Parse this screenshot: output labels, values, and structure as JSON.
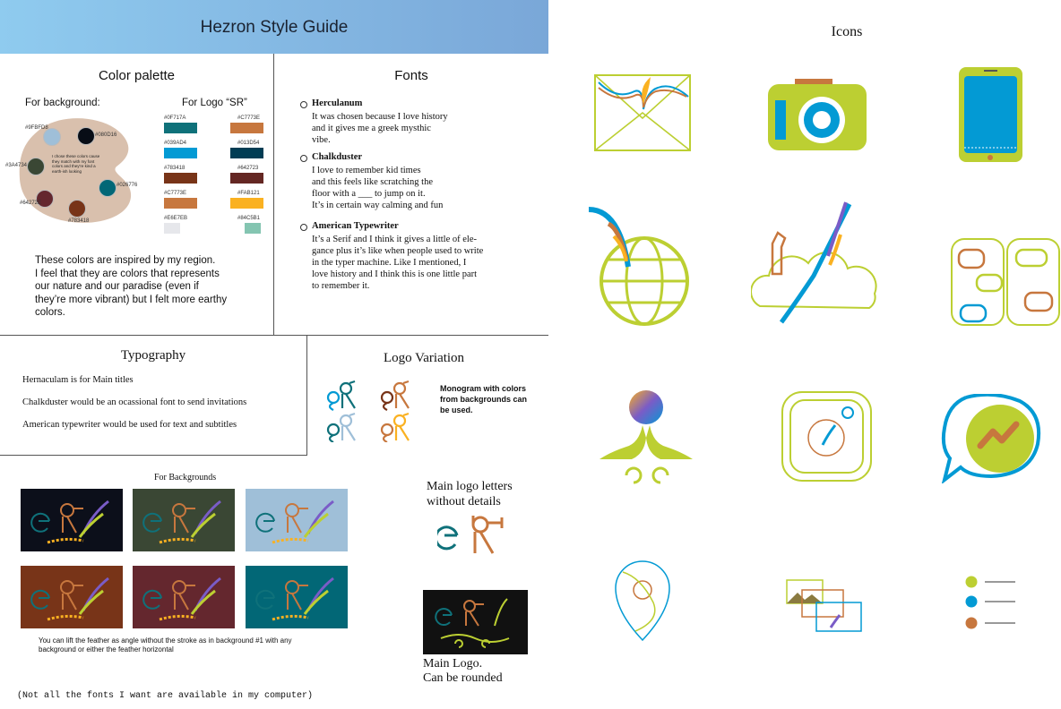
{
  "header": {
    "title": "Hezron Style Guide"
  },
  "color_palette": {
    "title": "Color palette",
    "background_label": "For background:",
    "logo_label": "For Logo “SR”",
    "palette_dots": [
      {
        "hex": "#9FBFD8",
        "label": "#9FBFD8"
      },
      {
        "hex": "#080D16",
        "label": "#080D16"
      },
      {
        "hex": "#3A4734",
        "label": "#3A4734"
      },
      {
        "hex": "#026776",
        "label": "#026776"
      },
      {
        "hex": "#64272E",
        "label": "#64272E"
      },
      {
        "hex": "#783418",
        "label": "#783418"
      }
    ],
    "palette_note": "I chose these colors cause they match with my font colors and they're kind a earth-ish looking",
    "logo_swatches": [
      {
        "hex": "#0F717A",
        "label": "#0F717A"
      },
      {
        "hex": "#C7773E",
        "label": "#C7773E"
      },
      {
        "hex": "#039AD4",
        "label": "#039AD4"
      },
      {
        "hex": "#013D54",
        "label": "#013D54"
      },
      {
        "hex": "#783418",
        "label": "#783418"
      },
      {
        "hex": "#642723",
        "label": "#642723"
      },
      {
        "hex": "#C7773E",
        "label": "#C7773E"
      },
      {
        "hex": "#FAB121",
        "label": "#FAB121"
      },
      {
        "hex": "#E6E7EB",
        "label": "#E6E7EB"
      },
      {
        "hex": "#84C5B1",
        "label": "#84C5B1"
      }
    ],
    "description_lines": [
      "These colors are inspired by my region.",
      "I feel that they are colors that represents",
      "our nature and our paradise (even if",
      "they’re more vibrant) but I felt more earthy",
      "colors."
    ]
  },
  "fonts": {
    "title": "Fonts",
    "items": [
      {
        "name": "Herculanum",
        "description": "It was chosen because I love history\nand it gives me a greek mysthic\nvibe."
      },
      {
        "name": "Chalkduster",
        "description": "I love to remember kid times\nand this feels like scratching the\nfloor with a ___ to jump on it.\nIt’s in certain way calming and fun"
      },
      {
        "name": "American Typewriter",
        "description": "It’s a Serif and I think it gives a little of ele-\ngance plus it’s like when people used to write\nin the typer machine. Like I mentioned, I\nlove history and I think this is one little part\nto remember it."
      }
    ]
  },
  "typography": {
    "title": "Typography",
    "lines": [
      "Hernaculam is for Main titles",
      "Chalkduster would be an ocassional font to send invitations",
      "American typewriter would be used for text and subtitles"
    ]
  },
  "logo_variation": {
    "title": "Logo Variation",
    "note_lines": [
      "Monogram with colors",
      "from backgrounds can",
      "be used."
    ]
  },
  "backgrounds": {
    "title": "For Backgrounds",
    "colors": [
      "#0c0f1a",
      "#3a4734",
      "#9fbfd8",
      "#783418",
      "#64272e",
      "#026776"
    ],
    "note_lines": [
      "You can lift the feather as angle without the stroke as in background #1 with any",
      "background or either the feather horizontal"
    ]
  },
  "main_logo_letters": {
    "lines": [
      "Main logo letters",
      "without details"
    ]
  },
  "main_logo": {
    "lines": [
      "Main Logo.",
      "Can be rounded"
    ]
  },
  "footer_note": "(Not all the fonts I want are available in my computer)",
  "icons": {
    "title": "Icons",
    "names": [
      "mail-icon",
      "camera-icon",
      "tablet-icon",
      "globe-icon",
      "cloud-icon",
      "chat-bubbles-icon",
      "meditation-icon",
      "instagram-icon",
      "messenger-icon",
      "location-pin-icon",
      "gallery-icon",
      "list-icon"
    ],
    "colors": {
      "lime": "#bccf32",
      "blue": "#039ad4",
      "orange": "#c7773e"
    }
  }
}
